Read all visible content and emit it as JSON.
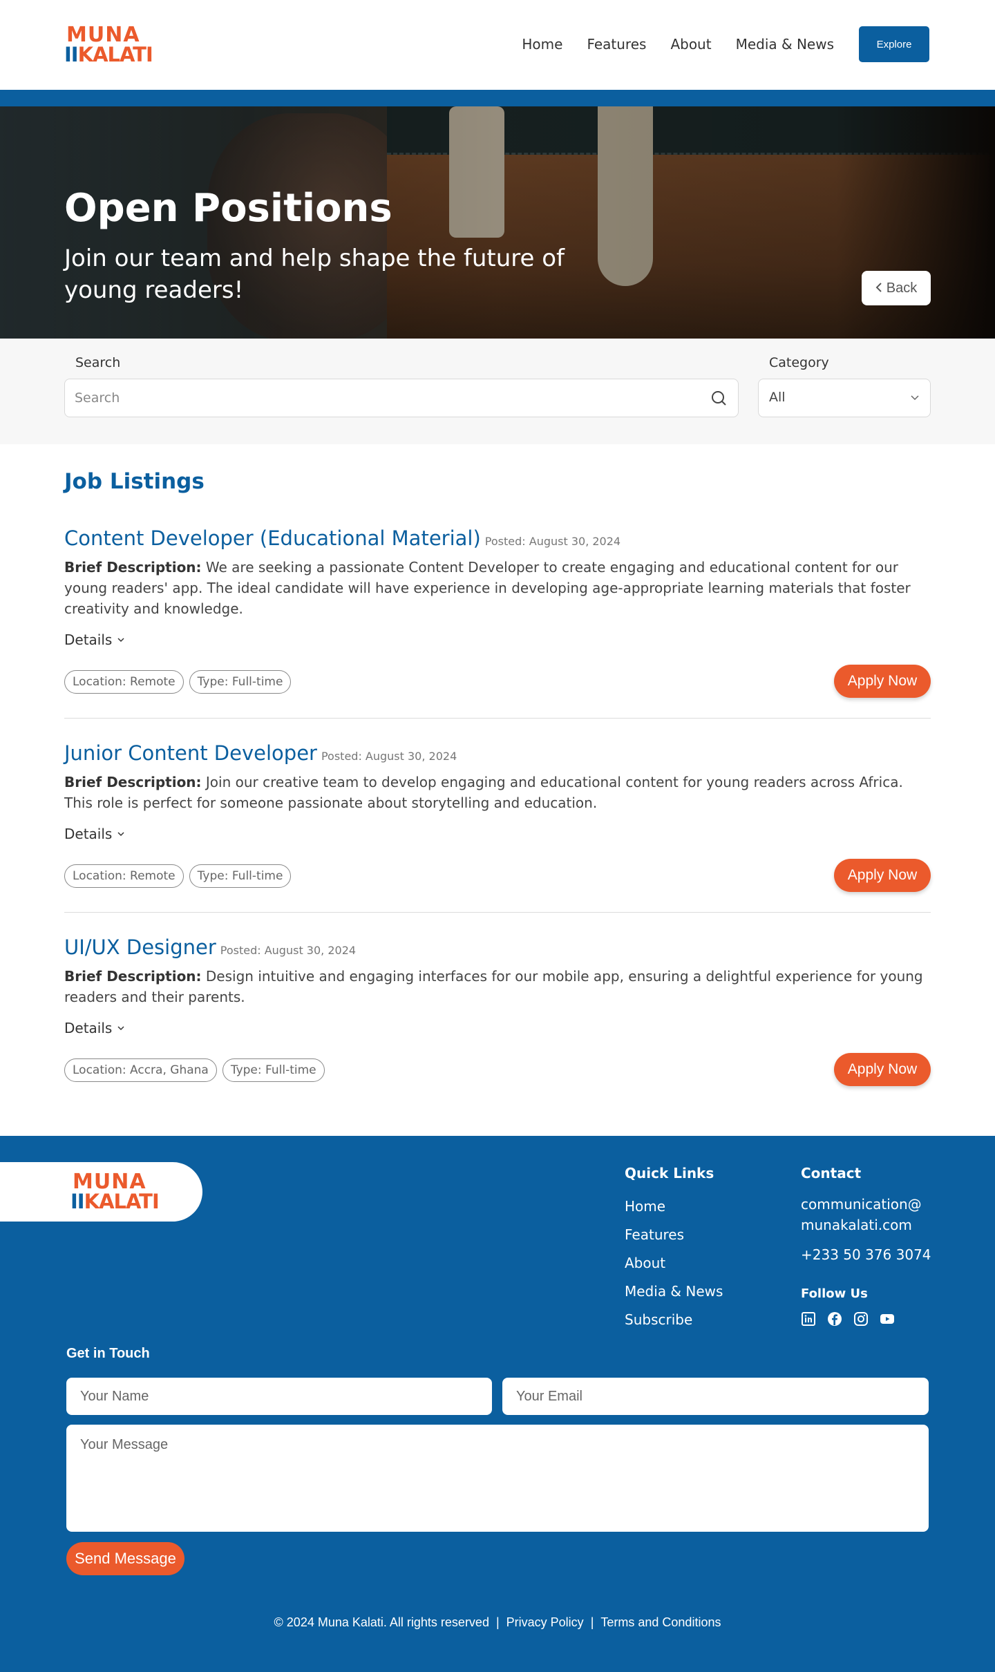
{
  "brand": {
    "logo_row1": "MUNA",
    "logo_row2_bars": "II",
    "logo_row2": "KALATI"
  },
  "nav": {
    "items": [
      "Home",
      "Features",
      "About",
      "Media & News"
    ],
    "cta_label": "Explore"
  },
  "hero": {
    "title": "Open Positions",
    "subtitle": "Join our team and help shape the future of young readers!",
    "back_label": "Back"
  },
  "filters": {
    "search_label": "Search",
    "search_placeholder": "Search",
    "category_label": "Category",
    "category_value": "All"
  },
  "listings": {
    "heading": "Job Listings",
    "details_label": "Details",
    "apply_label": "Apply Now",
    "desc_prefix": "Brief Description:",
    "jobs": [
      {
        "title": "Content Developer (Educational Material)",
        "posted": "Posted: August 30, 2024",
        "description": "We are seeking a passionate Content Developer to create engaging and educational content for our young readers' app. The ideal candidate will have experience in developing age-appropriate learning materials that foster creativity and knowledge.",
        "location": "Location: Remote",
        "type": "Type: Full-time"
      },
      {
        "title": "Junior Content Developer",
        "posted": "Posted: August 30, 2024",
        "description": "Join our creative team to develop engaging and educational content for young readers across Africa. This role is perfect for someone passionate about storytelling and education.",
        "location": "Location: Remote",
        "type": "Type: Full-time"
      },
      {
        "title": "UI/UX Designer",
        "posted": "Posted: August 30, 2024",
        "description": "Design intuitive and engaging interfaces for our mobile app, ensuring a delightful experience for young readers and their parents.",
        "location": "Location: Accra, Ghana",
        "type": "Type: Full-time"
      }
    ]
  },
  "footer": {
    "quick_links_title": "Quick Links",
    "quick_links": [
      "Home",
      "Features",
      "About",
      "Media & News",
      "Subscribe"
    ],
    "contact_title": "Contact",
    "email_line1": "communication@",
    "email_line2": "munakalati.com",
    "phone": "+233 50 376 3074",
    "follow_title": "Follow Us",
    "social_icons": [
      "linkedin-icon",
      "facebook-icon",
      "instagram-icon",
      "youtube-icon"
    ],
    "get_in_touch": "Get in Touch",
    "name_placeholder": "Your Name",
    "email_placeholder": "Your Email",
    "message_placeholder": "Your Message",
    "send_label": "Send Message",
    "copyright": "© 2024 Muna Kalati. All rights reserved",
    "privacy": "Privacy Policy",
    "terms": "Terms and Conditions"
  },
  "colors": {
    "primary": "#0b5f9f",
    "accent": "#eb5a2c"
  }
}
